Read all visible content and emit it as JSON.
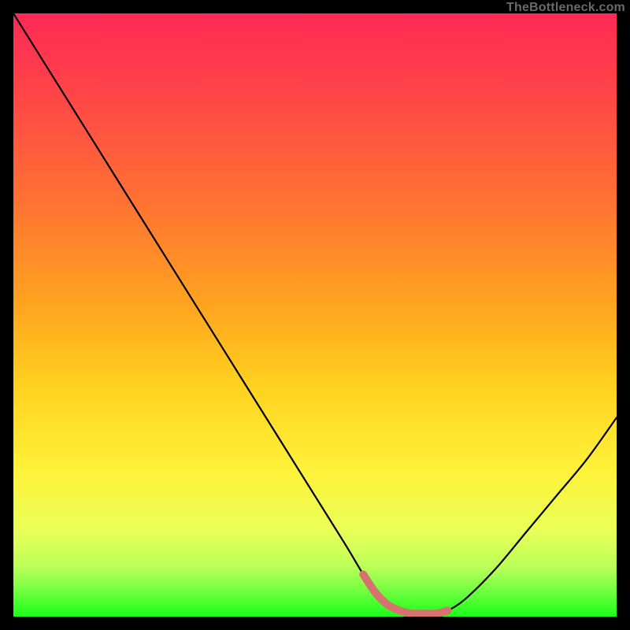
{
  "watermark": "TheBottleneck.com",
  "chart_data": {
    "type": "line",
    "title": "",
    "xlabel": "",
    "ylabel": "",
    "xlim": [
      0,
      100
    ],
    "ylim": [
      0,
      100
    ],
    "grid": false,
    "series": [
      {
        "name": "curve",
        "color": "#000000",
        "x": [
          0,
          5,
          10,
          15,
          20,
          25,
          30,
          35,
          40,
          45,
          50,
          55,
          58,
          60,
          62,
          64,
          66,
          68,
          70,
          72,
          75,
          80,
          85,
          90,
          95,
          100
        ],
        "y": [
          100,
          92,
          84,
          76,
          68,
          60,
          52,
          44,
          36,
          28,
          20,
          12,
          7,
          4,
          2,
          1,
          0.5,
          0.5,
          0.5,
          1,
          3,
          8,
          14,
          20,
          26,
          33
        ]
      },
      {
        "name": "highlight",
        "color": "#d6736e",
        "x": [
          58,
          60,
          62,
          64,
          66,
          68,
          70,
          72
        ],
        "y": [
          7,
          4,
          2,
          1,
          0.5,
          0.5,
          0.5,
          1
        ]
      }
    ]
  }
}
